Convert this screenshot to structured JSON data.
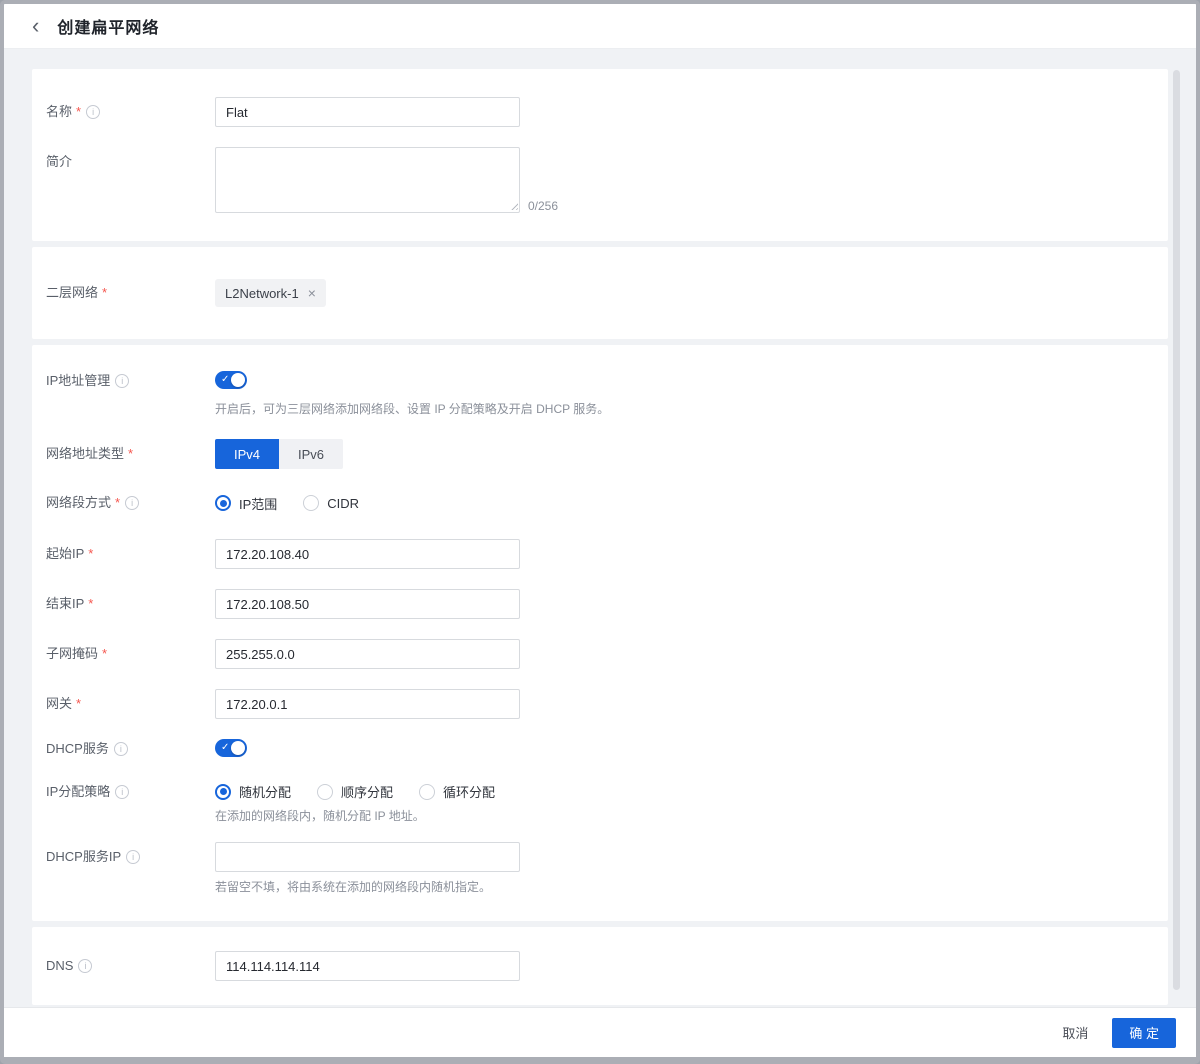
{
  "icons": {
    "back": "‹",
    "info": "i",
    "close": "×",
    "check": "✓"
  },
  "misc": {
    "required_mark": "*"
  },
  "colors": {
    "primary": "#1765db",
    "danger": "#f5564e"
  },
  "header": {
    "title": "创建扁平网络"
  },
  "form": {
    "name": {
      "label": "名称",
      "value": "Flat"
    },
    "description": {
      "label": "简介",
      "value": "",
      "counter": "0/256"
    },
    "l2network": {
      "label": "二层网络",
      "tag": "L2Network-1"
    },
    "ip_mgmt": {
      "label": "IP地址管理",
      "enabled": true,
      "desc": "开启后，可为三层网络添加网络段、设置 IP 分配策略及开启 DHCP 服务。"
    },
    "addr_type": {
      "label": "网络地址类型",
      "options": [
        {
          "label": "IPv4"
        },
        {
          "label": "IPv6"
        }
      ],
      "selected": "IPv4"
    },
    "segment_mode": {
      "label": "网络段方式",
      "options": [
        {
          "label": "IP范围"
        },
        {
          "label": "CIDR"
        }
      ],
      "selected": "IP范围"
    },
    "start_ip": {
      "label": "起始IP",
      "value": "172.20.108.40"
    },
    "end_ip": {
      "label": "结束IP",
      "value": "172.20.108.50"
    },
    "netmask": {
      "label": "子网掩码",
      "value": "255.255.0.0"
    },
    "gateway": {
      "label": "网关",
      "value": "172.20.0.1"
    },
    "dhcp": {
      "label": "DHCP服务",
      "enabled": true
    },
    "ip_policy": {
      "label": "IP分配策略",
      "options": [
        {
          "label": "随机分配"
        },
        {
          "label": "顺序分配"
        },
        {
          "label": "循环分配"
        }
      ],
      "selected": "随机分配",
      "desc": "在添加的网络段内，随机分配 IP 地址。"
    },
    "dhcp_ip": {
      "label": "DHCP服务IP",
      "value": "",
      "desc": "若留空不填，将由系统在添加的网络段内随机指定。"
    },
    "dns": {
      "label": "DNS",
      "value": "114.114.114.114"
    }
  },
  "footer": {
    "cancel": "取消",
    "ok": "确 定"
  }
}
